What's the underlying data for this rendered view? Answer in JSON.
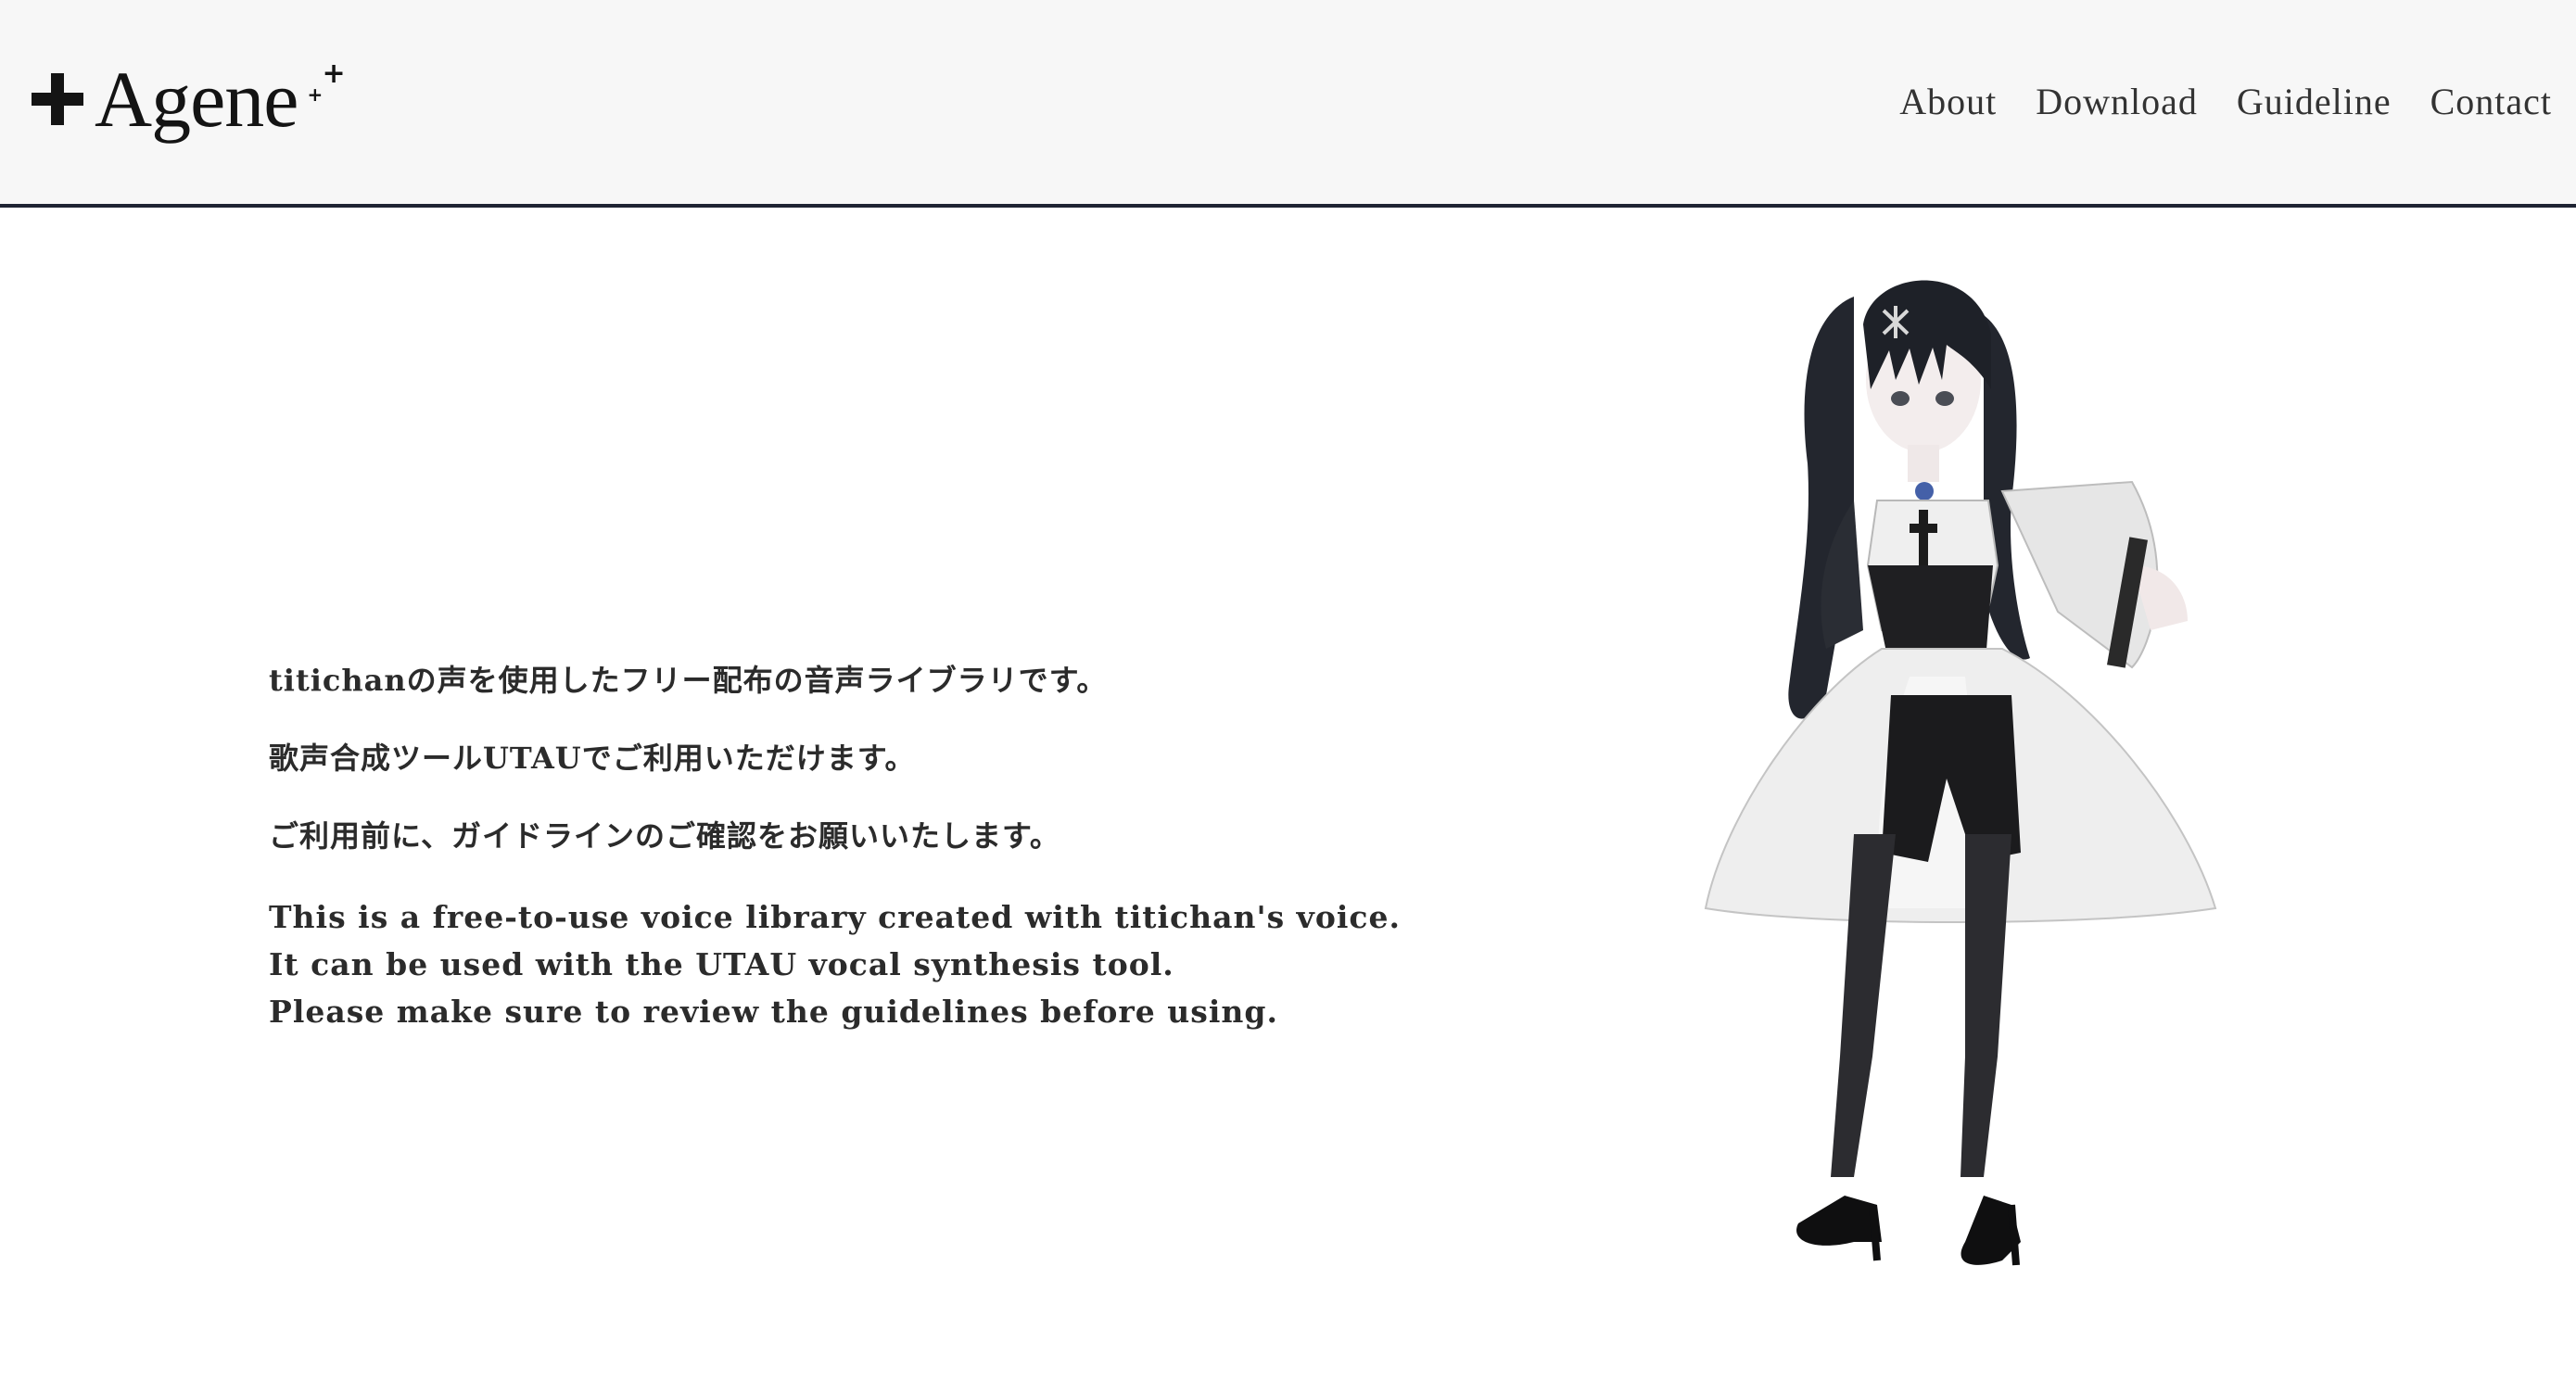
{
  "header": {
    "logo_text": "Agene",
    "nav": [
      {
        "label": "About"
      },
      {
        "label": "Download"
      },
      {
        "label": "Guideline"
      },
      {
        "label": "Contact"
      }
    ]
  },
  "intro": {
    "jp_lines": [
      "titichanの声を使用したフリー配布の音声ライブラリです。",
      "歌声合成ツールUTAUでご利用いただけます。",
      "ご利用前に、ガイドラインのご確認をお願いいたします。"
    ],
    "en_lines": [
      "This is a free-to-use voice library created with titichan's voice.",
      "It can be used with the UTAU vocal synthesis tool.",
      "Please make sure to review the guidelines before using."
    ]
  },
  "colors": {
    "header_bg": "#f7f7f7",
    "header_border": "#1f2433",
    "text": "#2b2b2b"
  },
  "figure": {
    "icon": "character-illustration"
  }
}
